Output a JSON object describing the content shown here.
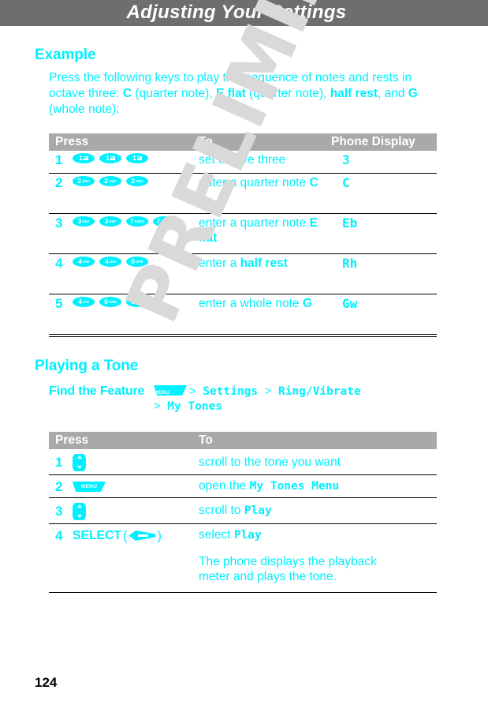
{
  "header": {
    "title": "Adjusting Your Settings",
    "bar_color": "#6e6e6e"
  },
  "watermark": {
    "text": "PRELIMINARY",
    "color": "#d9d9d9"
  },
  "accent_color": "#00f0ff",
  "table_header_color": "#a9a9a9",
  "example_section": {
    "heading": "Example",
    "paragraph_prefix": "Press the following keys to play this sequence of notes and rests in octave three: ",
    "note_1": "C",
    "paragraph_mid_1": " (quarter note), ",
    "note_2": "E flat",
    "paragraph_mid_2": " (quarter note), ",
    "note_3": "half rest",
    "paragraph_mid_3": ", and ",
    "note_4": "G",
    "paragraph_suffix": " (whole note):"
  },
  "table1": {
    "columns": [
      "Press",
      "To",
      "Phone Display"
    ],
    "rows": [
      {
        "step": "1",
        "keys": [
          {
            "type": "pad",
            "digit": "1",
            "letters": "envelope"
          },
          {
            "type": "pad",
            "digit": "1",
            "letters": "envelope"
          },
          {
            "type": "pad",
            "digit": "1",
            "letters": "envelope"
          }
        ],
        "to_plain": "set octave three",
        "to_bold": "",
        "display": "3"
      },
      {
        "step": "2",
        "keys": [
          {
            "type": "pad",
            "digit": "2",
            "letters": "ABC"
          },
          {
            "type": "pad",
            "digit": "2",
            "letters": "ABC"
          },
          {
            "type": "pad",
            "digit": "2",
            "letters": "ABC"
          }
        ],
        "to_plain": "enter a quarter note ",
        "to_bold": "C",
        "display": "C"
      },
      {
        "step": "3",
        "keys": [
          {
            "type": "pad",
            "digit": "3",
            "letters": "DEF"
          },
          {
            "type": "pad",
            "digit": "3",
            "letters": "DEF"
          },
          {
            "type": "pad",
            "digit": "7",
            "letters": "PQRS"
          },
          {
            "type": "pad",
            "digit": "7",
            "letters": "PQRS"
          }
        ],
        "to_plain": "enter a quarter note ",
        "to_bold": "E flat",
        "display": "Eb"
      },
      {
        "step": "4",
        "keys": [
          {
            "type": "pad",
            "digit": "4",
            "letters": "GHI"
          },
          {
            "type": "pad",
            "digit": "4",
            "letters": "GHI"
          },
          {
            "type": "pad",
            "digit": "0",
            "letters": "OPR"
          }
        ],
        "to_plain": "enter a ",
        "to_bold": "half rest",
        "display": "Rh"
      },
      {
        "step": "5",
        "keys": [
          {
            "type": "pad",
            "digit": "4",
            "letters": "GHI"
          },
          {
            "type": "pad",
            "digit": "0",
            "letters": "OPR"
          },
          {
            "type": "pad",
            "digit": "0",
            "letters": "OPR"
          }
        ],
        "to_plain": "enter a whole note ",
        "to_bold": "G",
        "display": "Gw"
      }
    ]
  },
  "tone_section": {
    "heading": "Playing a Tone",
    "find_the_feature": {
      "label": "Find the Feature",
      "menu_key_label": "MENU",
      "separator": ">",
      "path_items": [
        "Settings",
        "Ring/Vibrate",
        "My Tones"
      ]
    }
  },
  "table2": {
    "columns": [
      "Press",
      "To"
    ],
    "rows": [
      {
        "step": "1",
        "key_type": "scroll",
        "key_label": "",
        "to_plain": "scroll to the tone you want",
        "to_bold": ""
      },
      {
        "step": "2",
        "key_type": "menu",
        "key_label": "MENU",
        "to_plain": "open the ",
        "to_bold": "My Tones Menu"
      },
      {
        "step": "3",
        "key_type": "scroll",
        "key_label": "",
        "to_plain": "scroll to ",
        "to_bold": "Play"
      },
      {
        "step": "4",
        "key_type": "softkey",
        "key_label": "SELECT",
        "to_plain": "select ",
        "to_bold": "Play"
      }
    ],
    "note": "The phone displays the playback meter and plays the tone."
  },
  "page_number": "124"
}
